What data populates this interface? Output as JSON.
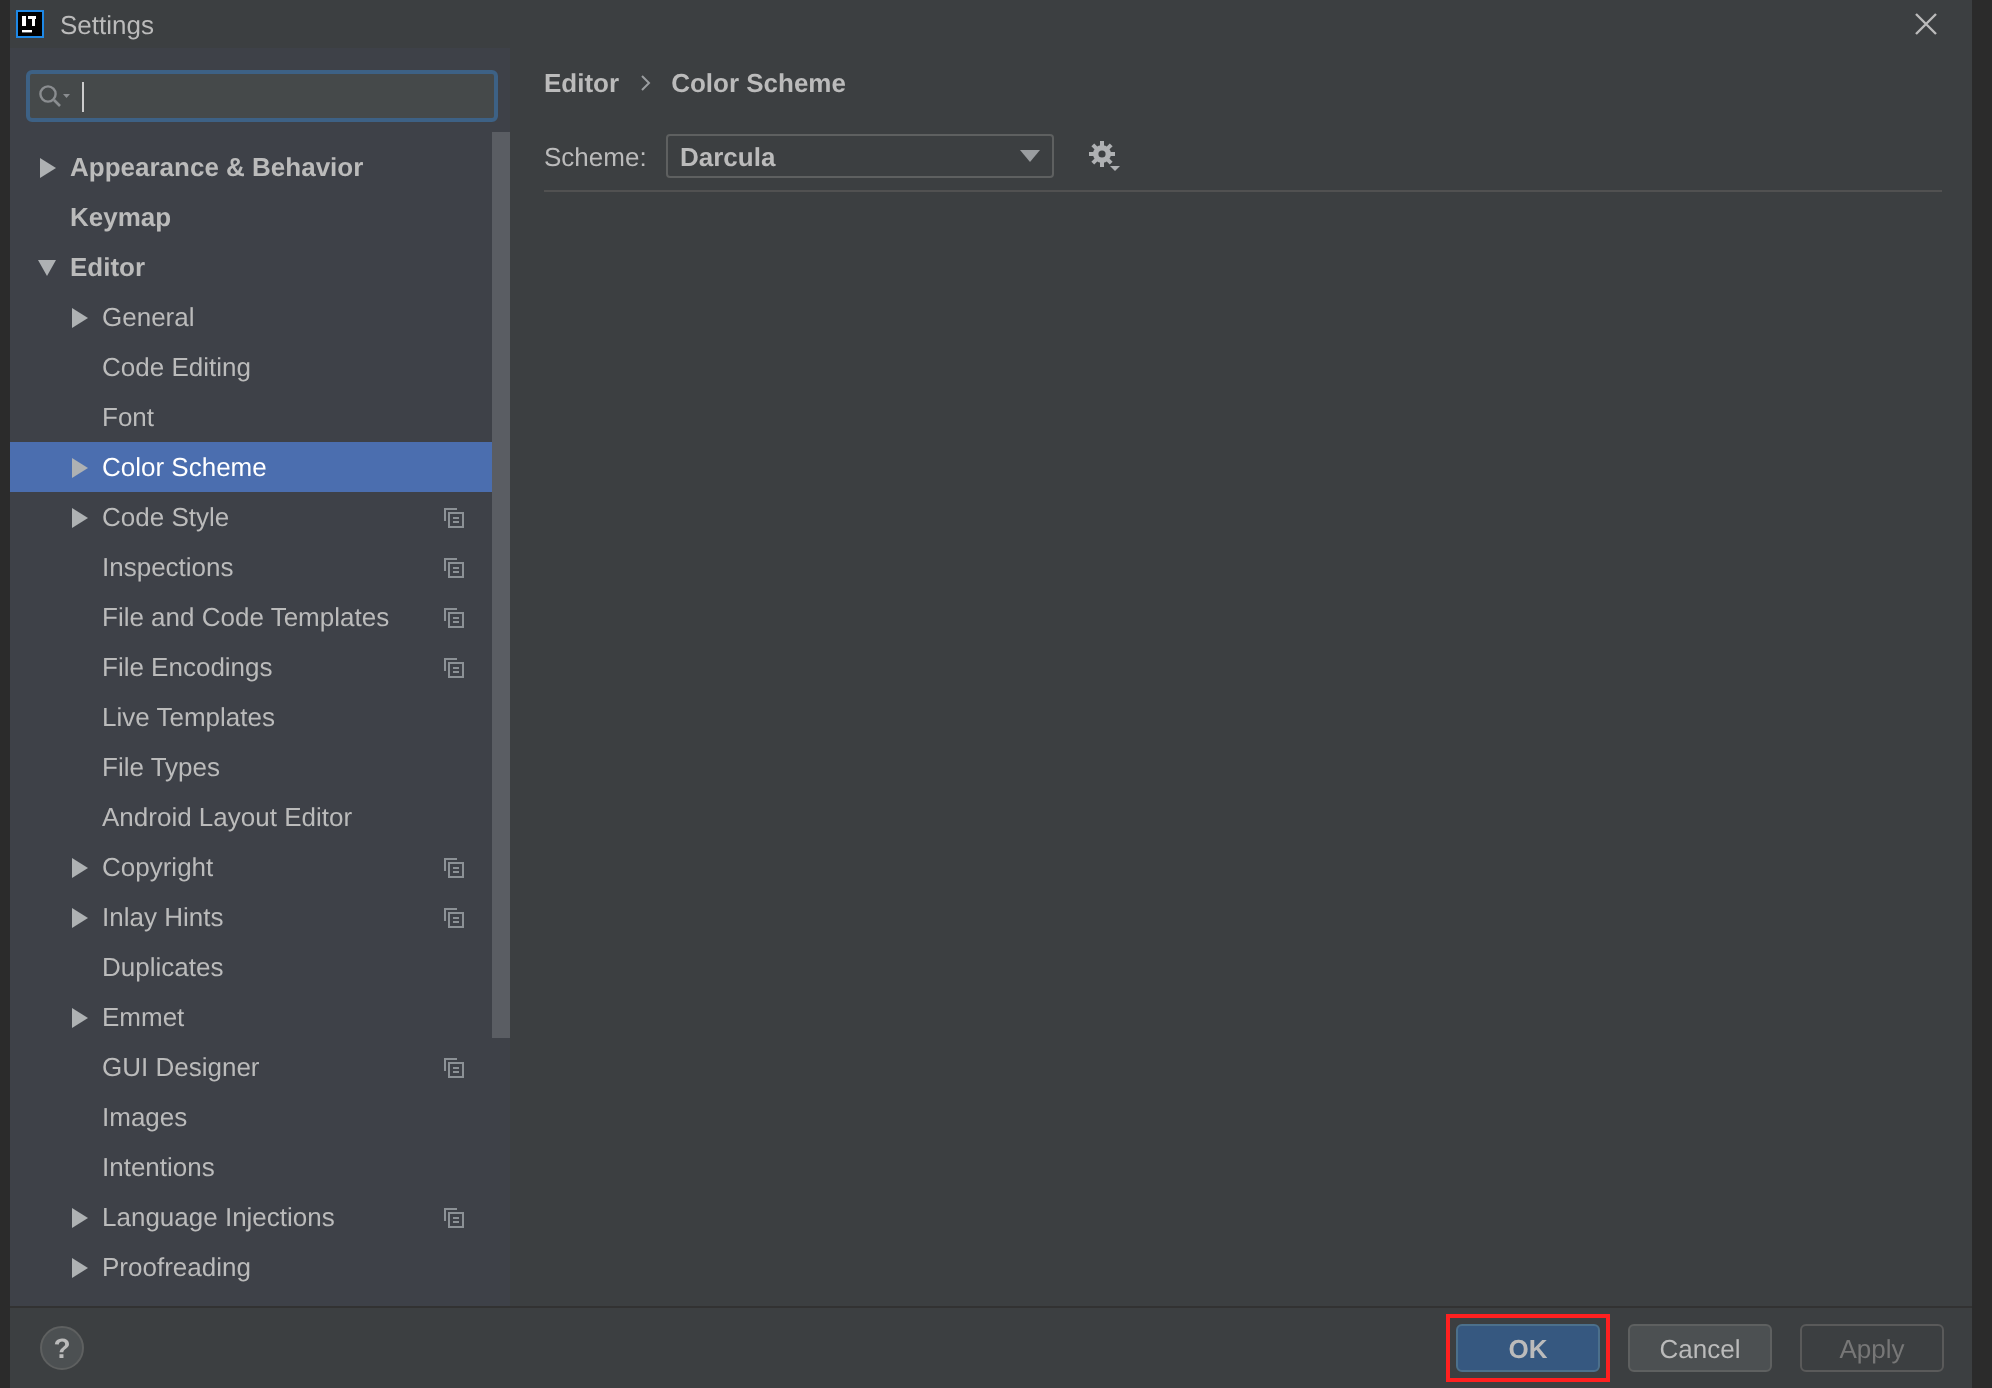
{
  "window": {
    "title": "Settings"
  },
  "tree": [
    {
      "label": "Appearance & Behavior",
      "expanded": false,
      "selected": false
    },
    {
      "label": "Keymap",
      "selected": false
    },
    {
      "label": "Editor",
      "expanded": true,
      "selected": false,
      "children": [
        {
          "label": "General",
          "expanded": false,
          "selected": false
        },
        {
          "label": "Code Editing",
          "selected": false
        },
        {
          "label": "Font",
          "selected": false
        },
        {
          "label": "Color Scheme",
          "expanded": false,
          "selected": true
        },
        {
          "label": "Code Style",
          "expanded": false,
          "selected": false,
          "project_level": true
        },
        {
          "label": "Inspections",
          "selected": false,
          "project_level": true
        },
        {
          "label": "File and Code Templates",
          "selected": false,
          "project_level": true
        },
        {
          "label": "File Encodings",
          "selected": false,
          "project_level": true
        },
        {
          "label": "Live Templates",
          "selected": false
        },
        {
          "label": "File Types",
          "selected": false
        },
        {
          "label": "Android Layout Editor",
          "selected": false
        },
        {
          "label": "Copyright",
          "expanded": false,
          "selected": false,
          "project_level": true
        },
        {
          "label": "Inlay Hints",
          "expanded": false,
          "selected": false,
          "project_level": true
        },
        {
          "label": "Duplicates",
          "selected": false
        },
        {
          "label": "Emmet",
          "expanded": false,
          "selected": false
        },
        {
          "label": "GUI Designer",
          "selected": false,
          "project_level": true
        },
        {
          "label": "Images",
          "selected": false
        },
        {
          "label": "Intentions",
          "selected": false
        },
        {
          "label": "Language Injections",
          "expanded": false,
          "selected": false,
          "project_level": true
        },
        {
          "label": "Proofreading",
          "expanded": false,
          "selected": false
        }
      ]
    }
  ],
  "breadcrumb": [
    "Editor",
    "Color Scheme"
  ],
  "scheme": {
    "label": "Scheme:",
    "value": "Darcula"
  },
  "help": "?",
  "buttons": [
    {
      "label": "OK",
      "default": true,
      "disabled": false,
      "highlighted": true
    },
    {
      "label": "Cancel",
      "default": false,
      "disabled": false,
      "highlighted": false
    },
    {
      "label": "Apply",
      "default": false,
      "disabled": true,
      "highlighted": false
    }
  ]
}
